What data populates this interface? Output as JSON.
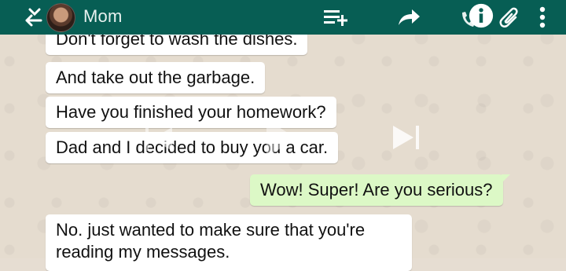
{
  "header": {
    "contact_name": "Mom",
    "icons": [
      "back-arrow-icon",
      "avatar",
      "add-to-list-icon",
      "forward-icon",
      "call-icon",
      "info-icon",
      "attach-icon",
      "more-options-icon"
    ],
    "bg_color": "#075e54"
  },
  "messages": [
    {
      "direction": "incoming",
      "text": "Don't forget to wash the dishes."
    },
    {
      "direction": "incoming",
      "text": "And take out the garbage."
    },
    {
      "direction": "incoming",
      "text": "Have you finished your homework?"
    },
    {
      "direction": "incoming",
      "text": "Dad and I decided to buy you a car."
    },
    {
      "direction": "outgoing",
      "text": "Wow! Super! Are you serious?"
    },
    {
      "direction": "incoming",
      "text": "No. just wanted to make sure that you're reading my messages."
    }
  ],
  "player_overlay": {
    "icons": [
      "previous-icon",
      "play-icon",
      "next-icon"
    ]
  },
  "colors": {
    "incoming_bubble": "#ffffff",
    "outgoing_bubble": "#dcf8c6",
    "chat_background": "#e5dccf"
  }
}
